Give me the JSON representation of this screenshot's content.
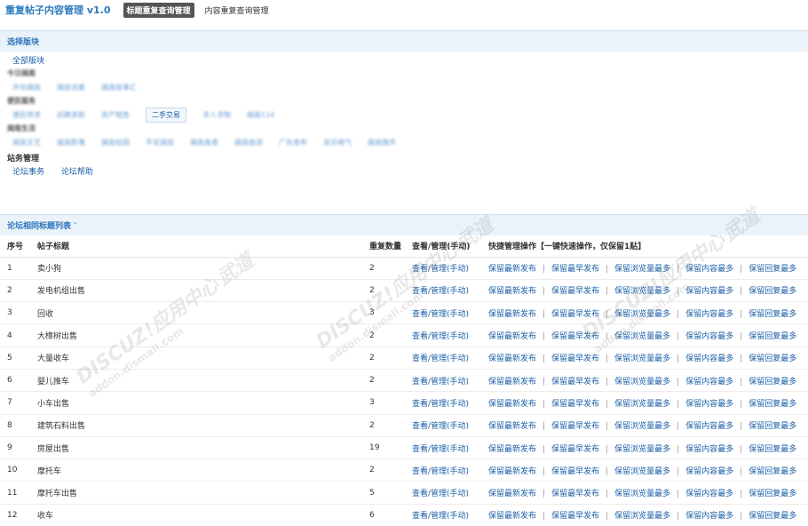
{
  "header": {
    "title": "重复帖子内容管理 v1.0",
    "tabs": [
      {
        "label": "标题重复查询管理",
        "active": true
      },
      {
        "label": "内容重复查询管理",
        "active": false
      }
    ]
  },
  "forum_select": {
    "section_title": "选择版块",
    "all_label": "全部版块",
    "groups": [
      {
        "title": "今日闽南",
        "items": [
          "声也闽南",
          "闽南说案",
          "闽南故事汇"
        ]
      },
      {
        "title": "便民服务",
        "items": [
          "便民供求",
          "招聘求职",
          "房产租售",
          "二手交易",
          "寻人寻物",
          "闽南114"
        ],
        "selected": "二手交易"
      },
      {
        "title": "闽南生活",
        "items": [
          "闽南文艺",
          "闽南影像",
          "闽南校园",
          "平安闽南",
          "闽南美食",
          "闽南旅游",
          "广告发布",
          "音乐嗅气",
          "闽南情声"
        ]
      }
    ],
    "admin_title": "站务管理",
    "admin_items": [
      "论坛事务",
      "论坛帮助"
    ]
  },
  "list": {
    "section_title": "论坛相同标题列表",
    "section_arrow": "˅",
    "columns": {
      "no": "序号",
      "title": "帖子标题",
      "count": "重复数量",
      "view": "查看/管理(手动)",
      "actions": "快捷管理操作【一键快速操作，仅保留1贴】"
    },
    "view_label": "查看/管理(手动)",
    "action_labels": [
      "保留最新发布",
      "保留最早发布",
      "保留浏览量最多",
      "保留内容最多",
      "保留回复最多"
    ],
    "separator": "|",
    "rows": [
      {
        "no": "1",
        "title": "卖小狗",
        "count": "2"
      },
      {
        "no": "2",
        "title": "发电机组出售",
        "count": "2"
      },
      {
        "no": "3",
        "title": "回收",
        "count": "3"
      },
      {
        "no": "4",
        "title": "大樟树出售",
        "count": "2"
      },
      {
        "no": "5",
        "title": "大量收车",
        "count": "2"
      },
      {
        "no": "6",
        "title": "婴儿推车",
        "count": "2"
      },
      {
        "no": "7",
        "title": "小车出售",
        "count": "3"
      },
      {
        "no": "8",
        "title": "建筑石料出售",
        "count": "2"
      },
      {
        "no": "9",
        "title": "房屋出售",
        "count": "19"
      },
      {
        "no": "10",
        "title": "摩托车",
        "count": "2"
      },
      {
        "no": "11",
        "title": "摩托车出售",
        "count": "5"
      },
      {
        "no": "12",
        "title": "收车",
        "count": "6"
      }
    ]
  },
  "watermark": {
    "brand": "DISCUZ!应用中心",
    "cn": "武道",
    "domain": "addon.dismall.com"
  }
}
